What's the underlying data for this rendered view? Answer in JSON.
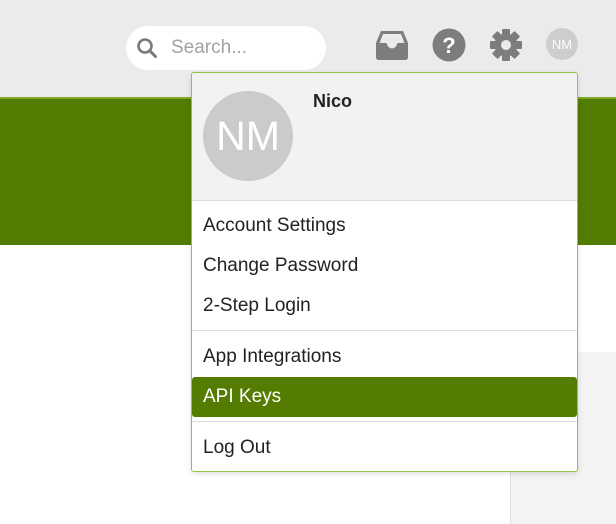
{
  "search": {
    "placeholder": "Search..."
  },
  "header": {
    "avatar_initials": "NM",
    "icons": [
      "inbox-icon",
      "help-icon",
      "settings-gear-icon"
    ]
  },
  "colors": {
    "brand_green": "#547c00",
    "menu_border": "#8ec63f",
    "topbar_bg": "#ebebeb"
  },
  "menu": {
    "user_initials": "NM",
    "user_name": "Nico",
    "items": [
      {
        "label": "Account Settings"
      },
      {
        "label": "Change Password"
      },
      {
        "label": "2-Step Login"
      },
      {
        "label": "App Integrations"
      },
      {
        "label": "API Keys",
        "active": true
      },
      {
        "label": "Log Out"
      }
    ]
  }
}
